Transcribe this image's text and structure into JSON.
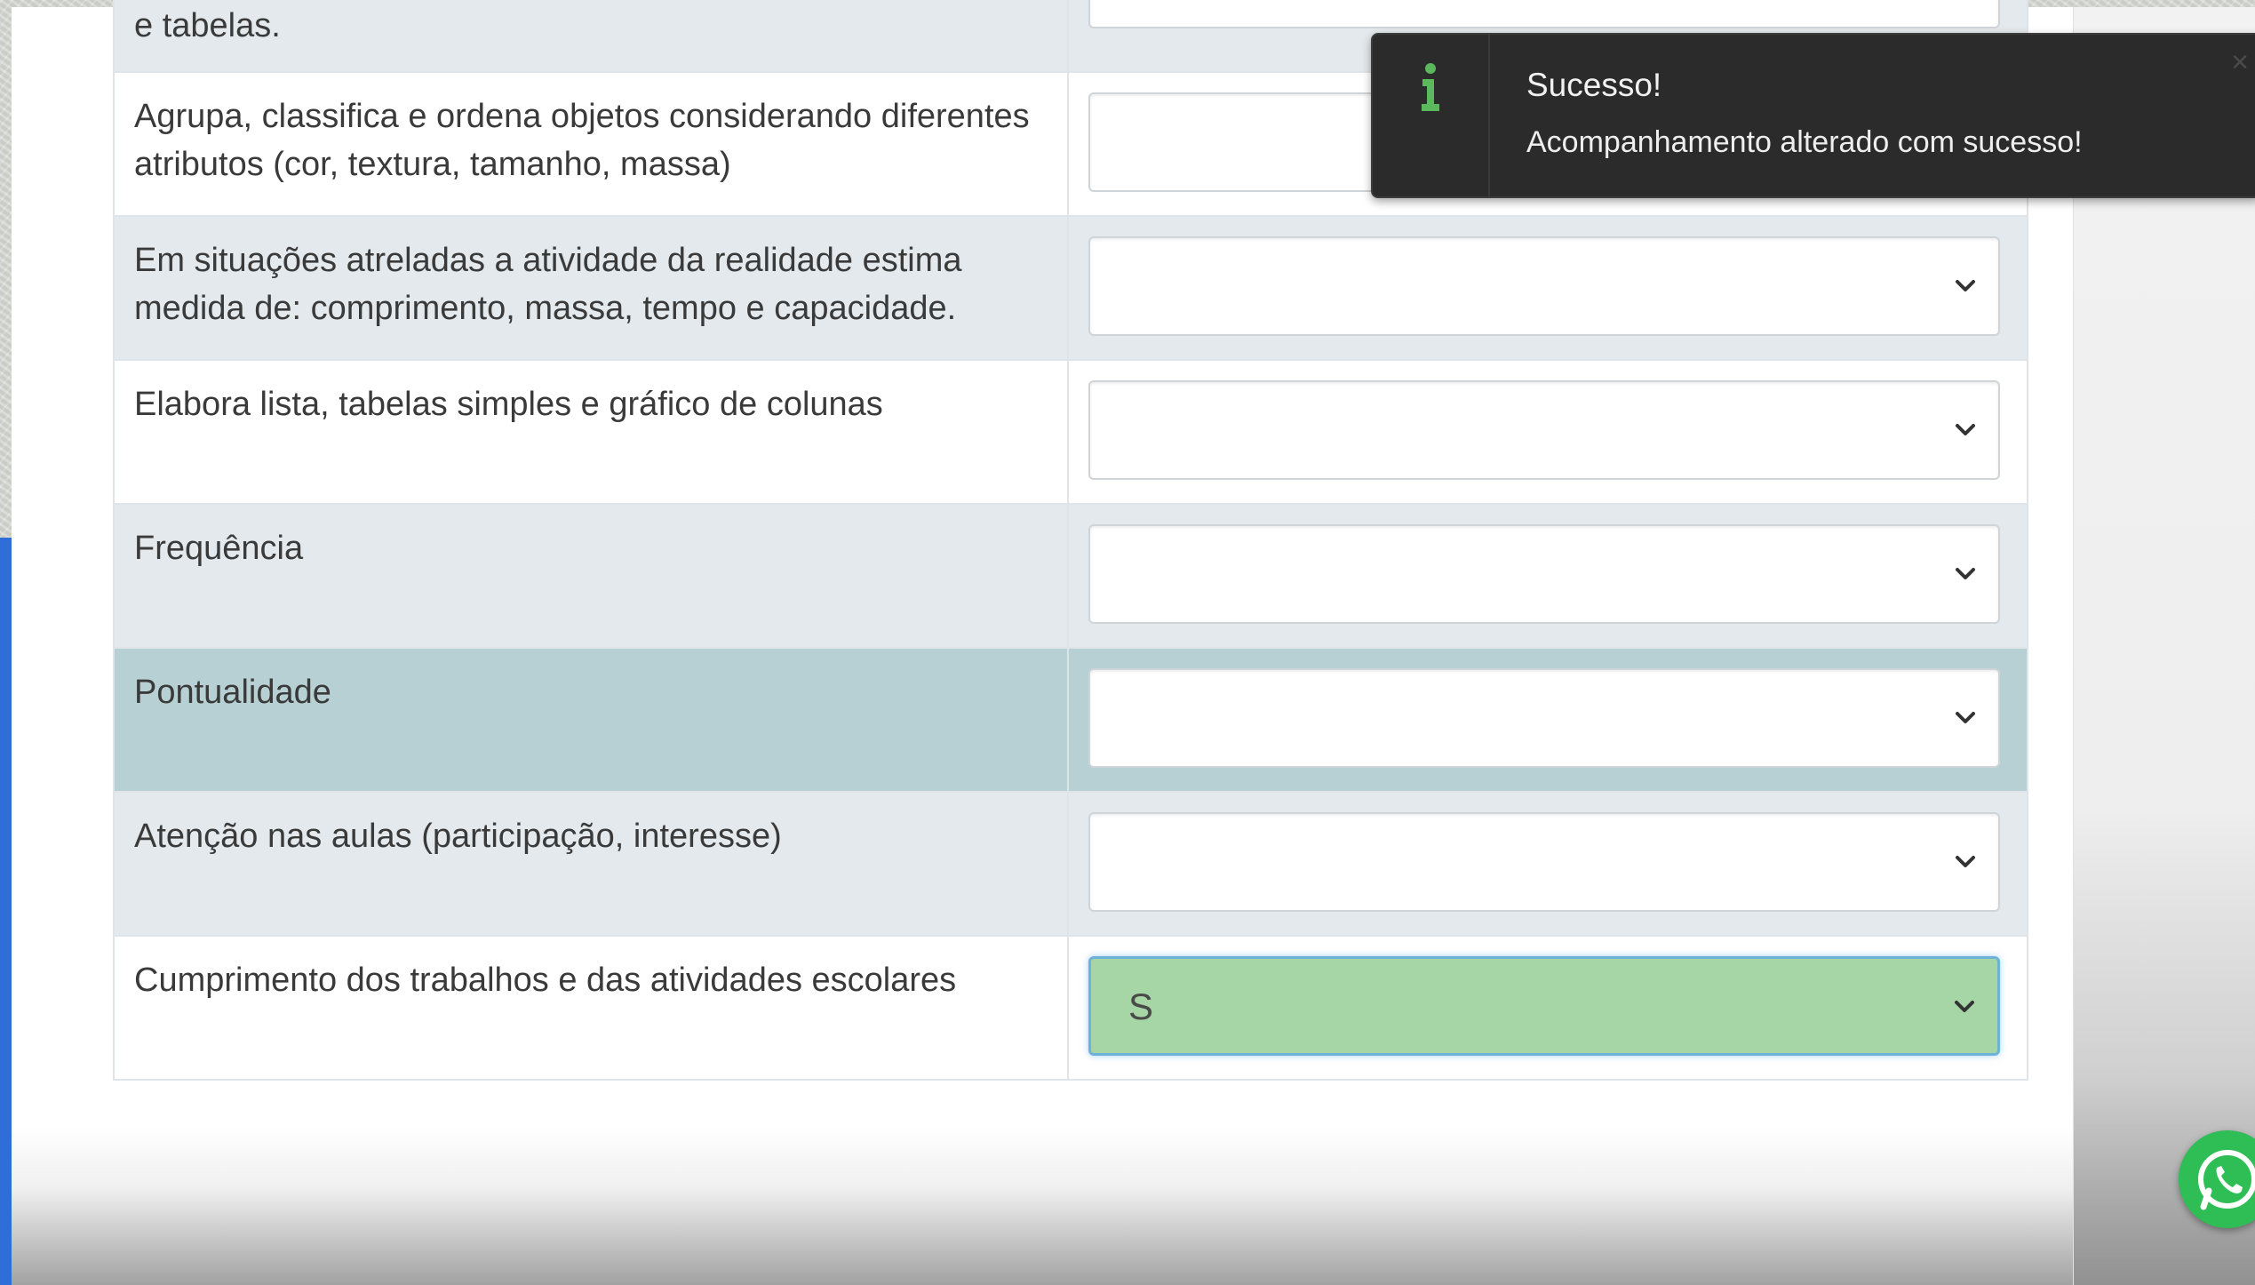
{
  "rows": [
    {
      "label": "e tabelas.",
      "value": "",
      "style": "alt"
    },
    {
      "label": "Agrupa, classifica e ordena objetos considerando diferentes atributos (cor, textura, tamanho, massa)",
      "value": "",
      "style": "plain"
    },
    {
      "label": "Em situações atreladas a atividade da realidade estima medida de: comprimento, massa, tempo e capacidade.",
      "value": "",
      "style": "alt"
    },
    {
      "label": "Elabora lista, tabelas simples e gráfico de colunas",
      "value": "",
      "style": "plain"
    },
    {
      "label": "Frequência",
      "value": "",
      "style": "alt"
    },
    {
      "label": "Pontualidade",
      "value": "",
      "style": "hover"
    },
    {
      "label": "Atenção nas aulas (participação, interesse)",
      "value": "",
      "style": "alt"
    },
    {
      "label": "Cumprimento dos trabalhos e das atividades escolares",
      "value": "S",
      "style": "plain"
    }
  ],
  "toast": {
    "title": "Sucesso!",
    "message": "Acompanhamento alterado com sucesso!",
    "close_label": "×",
    "icon": "info-icon",
    "accent_color": "#5cb85c"
  },
  "colors": {
    "selected_success_bg": "#a6d5a6",
    "row_alt_bg": "#e3e9ec",
    "row_hover_bg": "#b6d0d4",
    "whatsapp_green": "#2fbe55"
  },
  "icons": {
    "select_chevron": "chevron-down-icon",
    "whatsapp": "whatsapp-icon"
  }
}
